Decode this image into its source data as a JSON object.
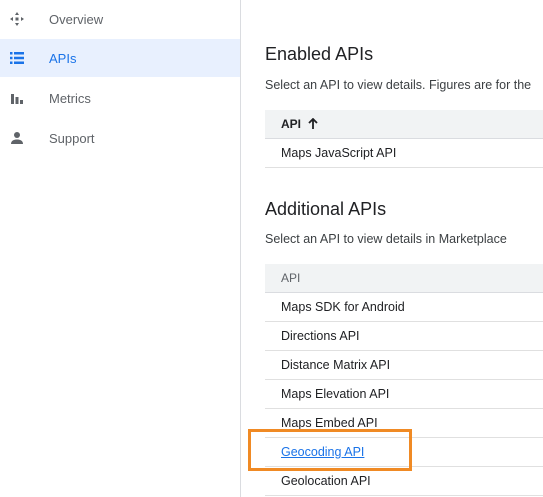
{
  "sidebar": {
    "items": [
      {
        "label": "Overview",
        "icon": "overview-icon",
        "active": false
      },
      {
        "label": "APIs",
        "icon": "list-icon",
        "active": true
      },
      {
        "label": "Metrics",
        "icon": "bar-chart-icon",
        "active": false
      },
      {
        "label": "Support",
        "icon": "person-icon",
        "active": false
      }
    ]
  },
  "enabled": {
    "title": "Enabled APIs",
    "description": "Select an API to view details. Figures are for the",
    "column_header": "API",
    "rows": [
      "Maps JavaScript API"
    ]
  },
  "additional": {
    "title": "Additional APIs",
    "description": "Select an API to view details in Marketplace",
    "column_header": "API",
    "rows": [
      "Maps SDK for Android",
      "Directions API",
      "Distance Matrix API",
      "Maps Elevation API",
      "Maps Embed API",
      "Geocoding API",
      "Geolocation API"
    ]
  },
  "colors": {
    "accent": "#1a73e8",
    "active_bg": "#e8f0fe",
    "highlight": "#f08a24"
  }
}
